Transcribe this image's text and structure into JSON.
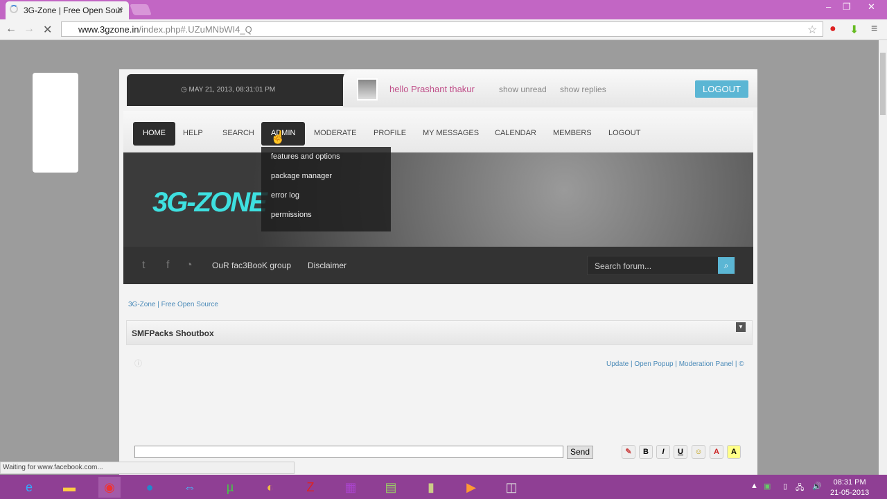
{
  "browser": {
    "tab_title": "3G-Zone | Free Open Sour",
    "url_domain": "www.3gzone.in",
    "url_path": "/index.php#.UZuMNbWI4_Q",
    "status": "Waiting for www.facebook.com..."
  },
  "header": {
    "date": "MAY 21, 2013, 08:31:01 PM",
    "greeting": "hello Prashant thakur",
    "show_unread": "show unread",
    "show_replies": "show replies",
    "logout": "LOGOUT"
  },
  "menu": [
    "HOME",
    "HELP",
    "SEARCH",
    "ADMIN",
    "MODERATE",
    "PROFILE",
    "MY MESSAGES",
    "CALENDAR",
    "MEMBERS",
    "LOGOUT"
  ],
  "admin_dropdown": [
    "features and options",
    "package manager",
    "error log",
    "permissions"
  ],
  "banner": {
    "logo": "3G-ZONE"
  },
  "social": {
    "facebook_group": "OuR fac3BooK group",
    "disclaimer": "Disclaimer",
    "search_placeholder": "Search forum..."
  },
  "breadcrumb": "3G-Zone | Free Open Source",
  "shoutbox": {
    "title": "SMFPacks Shoutbox",
    "links": "Update | Open Popup | Moderation Panel | ©",
    "send": "Send",
    "tools": [
      "B",
      "I",
      "U",
      "☺",
      "A",
      "A"
    ]
  },
  "taskbar": {
    "time": "08:31 PM",
    "date": "21-05-2013"
  }
}
